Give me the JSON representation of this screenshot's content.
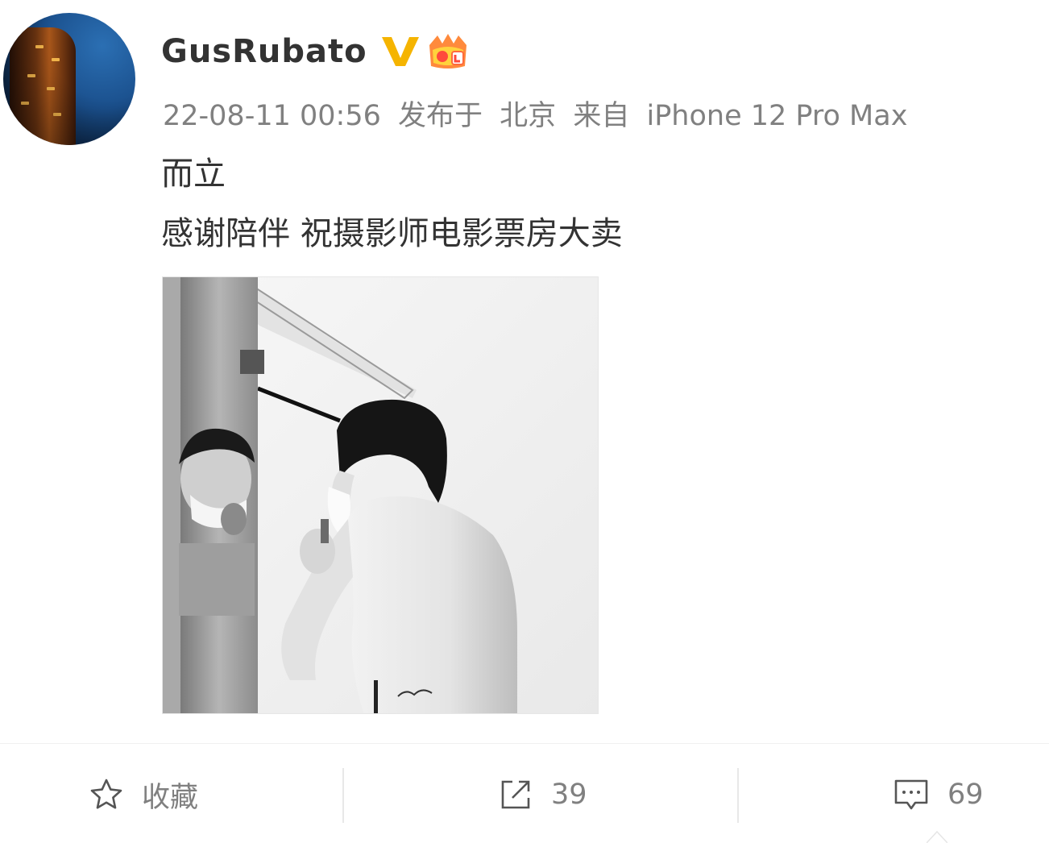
{
  "post": {
    "username": "GusRubato",
    "badges": {
      "verified_icon": "verified-v-icon",
      "vip_icon": "vip-crown-icon",
      "verified_color": "#f5b400",
      "vip_color": "#ff8a3c"
    },
    "meta": {
      "time": "22-08-11 00:56",
      "location_prefix": "发布于",
      "location": "北京",
      "source_prefix": "来自",
      "source": "iPhone 12 Pro Max"
    },
    "content": {
      "line1": "而立",
      "line2": "感谢陪伴 祝摄影师电影票房大卖"
    },
    "image": {
      "alt": "black-and-white photo of a man shaving in front of a mirror",
      "style": "grayscale"
    }
  },
  "toolbar": {
    "favorite": {
      "icon": "star-icon",
      "label": "收藏"
    },
    "repost": {
      "icon": "share-icon",
      "count": "39"
    },
    "comment": {
      "icon": "comment-icon",
      "count": "69"
    }
  }
}
